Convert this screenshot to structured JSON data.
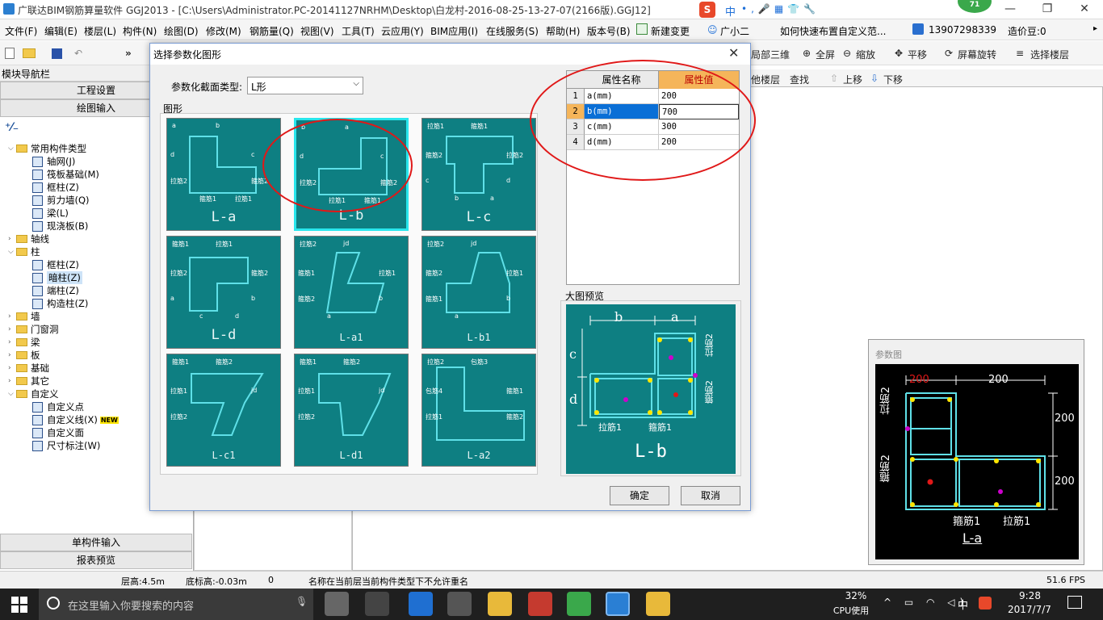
{
  "titlebar": {
    "title": "广联达BIM钢筋算量软件 GGJ2013 - [C:\\Users\\Administrator.PC-20141127NRHM\\Desktop\\白龙村-2016-08-25-13-27-07(2166版).GGJ12]",
    "ime_label": "中",
    "badge": "71",
    "min": "—",
    "max": "❐",
    "close": "✕"
  },
  "menu": {
    "items": [
      "文件(F)",
      "编辑(E)",
      "楼层(L)",
      "构件(N)",
      "绘图(D)",
      "修改(M)",
      "钢筋量(Q)",
      "视图(V)",
      "工具(T)",
      "云应用(Y)",
      "BIM应用(I)",
      "在线服务(S)",
      "帮助(H)",
      "版本号(B)"
    ],
    "new_change": "新建变更",
    "assistant": "广小二",
    "tip": "如何快速布置自定义范...",
    "phone": "13907298339",
    "coin": "造价豆:0"
  },
  "toolbar": {
    "items": [
      "局部三维",
      "全屏",
      "缩放",
      "平移",
      "屏幕旋转",
      "选择楼层"
    ],
    "row2": [
      "他楼层",
      "查找",
      "上移",
      "下移"
    ]
  },
  "nav": {
    "header": "模块导航栏",
    "btn_project": "工程设置",
    "btn_draw": "绘图输入",
    "btn_single": "单构件输入",
    "btn_report": "报表预览",
    "tree": [
      {
        "label": "常用构件类型",
        "level": 0,
        "type": "folder",
        "expanded": true
      },
      {
        "label": "轴网(J)",
        "level": 1,
        "type": "item"
      },
      {
        "label": "筏板基础(M)",
        "level": 1,
        "type": "item"
      },
      {
        "label": "框柱(Z)",
        "level": 1,
        "type": "item"
      },
      {
        "label": "剪力墙(Q)",
        "level": 1,
        "type": "item"
      },
      {
        "label": "梁(L)",
        "level": 1,
        "type": "item"
      },
      {
        "label": "现浇板(B)",
        "level": 1,
        "type": "item"
      },
      {
        "label": "轴线",
        "level": 0,
        "type": "folder",
        "expanded": false
      },
      {
        "label": "柱",
        "level": 0,
        "type": "folder",
        "expanded": true
      },
      {
        "label": "框柱(Z)",
        "level": 1,
        "type": "item"
      },
      {
        "label": "暗柱(Z)",
        "level": 1,
        "type": "item",
        "selected": true
      },
      {
        "label": "端柱(Z)",
        "level": 1,
        "type": "item"
      },
      {
        "label": "构造柱(Z)",
        "level": 1,
        "type": "item"
      },
      {
        "label": "墙",
        "level": 0,
        "type": "folder",
        "expanded": false
      },
      {
        "label": "门窗洞",
        "level": 0,
        "type": "folder",
        "expanded": false
      },
      {
        "label": "梁",
        "level": 0,
        "type": "folder",
        "expanded": false
      },
      {
        "label": "板",
        "level": 0,
        "type": "folder",
        "expanded": false
      },
      {
        "label": "基础",
        "level": 0,
        "type": "folder",
        "expanded": false
      },
      {
        "label": "其它",
        "level": 0,
        "type": "folder",
        "expanded": false
      },
      {
        "label": "自定义",
        "level": 0,
        "type": "folder",
        "expanded": true
      },
      {
        "label": "自定义点",
        "level": 1,
        "type": "item"
      },
      {
        "label": "自定义线(X)",
        "level": 1,
        "type": "item",
        "badge": "NEW"
      },
      {
        "label": "自定义面",
        "level": 1,
        "type": "item"
      },
      {
        "label": "尺寸标注(W)",
        "level": 1,
        "type": "item"
      }
    ]
  },
  "dialog": {
    "title": "选择参数化图形",
    "section_label": "参数化截面类型:",
    "section_value": "L形",
    "group_label": "图形",
    "tiles": [
      {
        "label": "L-a",
        "small": false,
        "texts": [
          "a",
          "b",
          "c",
          "d",
          "拉筋2",
          "箍筋2",
          "箍筋1",
          "拉筋1"
        ]
      },
      {
        "label": "L-b",
        "small": false,
        "selected": true,
        "texts": [
          "b",
          "a",
          "c",
          "d",
          "拉筋2",
          "箍筋2",
          "拉筋1",
          "箍筋1"
        ]
      },
      {
        "label": "L-c",
        "small": false,
        "texts": [
          "拉筋1",
          "箍筋1",
          "拉筋2",
          "箍筋2",
          "c",
          "d",
          "b",
          "a"
        ]
      },
      {
        "label": "L-d",
        "small": false,
        "texts": [
          "箍筋1",
          "拉筋1",
          "箍筋2",
          "拉筋2",
          "a",
          "b",
          "c",
          "d"
        ]
      },
      {
        "label": "L-a1",
        "small": true,
        "texts": [
          "拉筋2",
          "jd",
          "拉筋1",
          "箍筋1",
          "箍筋2",
          "b",
          "a"
        ]
      },
      {
        "label": "L-b1",
        "small": true,
        "texts": [
          "拉筋2",
          "jd",
          "拉筋1",
          "箍筋2",
          "箍筋1",
          "b",
          "a"
        ]
      },
      {
        "label": "L-c1",
        "small": true,
        "texts": [
          "箍筋1",
          "箍筋2",
          "jd",
          "拉筋1",
          "拉筋2"
        ]
      },
      {
        "label": "L-d1",
        "small": true,
        "texts": [
          "箍筋1",
          "箍筋2",
          "jd",
          "拉筋1",
          "拉筋2"
        ]
      },
      {
        "label": "L-a2",
        "small": true,
        "texts": [
          "拉筋2",
          "包筋3",
          "箍筋1",
          "包筋4",
          "拉筋1",
          "箍筋2"
        ]
      }
    ],
    "table": {
      "col_name": "属性名称",
      "col_value": "属性值",
      "rows": [
        {
          "idx": "1",
          "name": "a(mm)",
          "value": "200"
        },
        {
          "idx": "2",
          "name": "b(mm)",
          "value": "700",
          "selected": true
        },
        {
          "idx": "3",
          "name": "c(mm)",
          "value": "300"
        },
        {
          "idx": "4",
          "name": "d(mm)",
          "value": "200"
        }
      ]
    },
    "preview_label": "大图预览",
    "preview": {
      "b": "b",
      "a": "a",
      "c": "c",
      "d": "d",
      "lajin2": "拉筋2",
      "gujin2": "箍筋2",
      "lajin1": "拉筋1",
      "gujin1": "箍筋1",
      "name": "L-b"
    },
    "ok": "确定",
    "cancel": "取消"
  },
  "param_window": {
    "title": "参数图",
    "top_left": "200",
    "top_right": "200",
    "right_top": "200",
    "right_bottom": "200",
    "lajin2": "拉筋2",
    "gujin2": "箍筋2",
    "gujin1": "箍筋1",
    "lajin1": "拉筋1",
    "name": "L-a"
  },
  "status": {
    "floor_height": "层高:4.5m",
    "base_height": "底标高:-0.03m",
    "zero": "0",
    "message": "名称在当前层当前构件类型下不允许重名",
    "fps": "51.6 FPS"
  },
  "taskbar": {
    "search_placeholder": "在这里输入你要搜索的内容",
    "cpu_pct": "32%",
    "cpu_label": "CPU使用",
    "ime": "中",
    "time": "9:28",
    "date": "2017/7/7"
  },
  "colors": {
    "teal": "#0e7f82",
    "selected_border": "#29e6ec",
    "annotation_red": "#e01818",
    "line": "#5fe0e8"
  }
}
